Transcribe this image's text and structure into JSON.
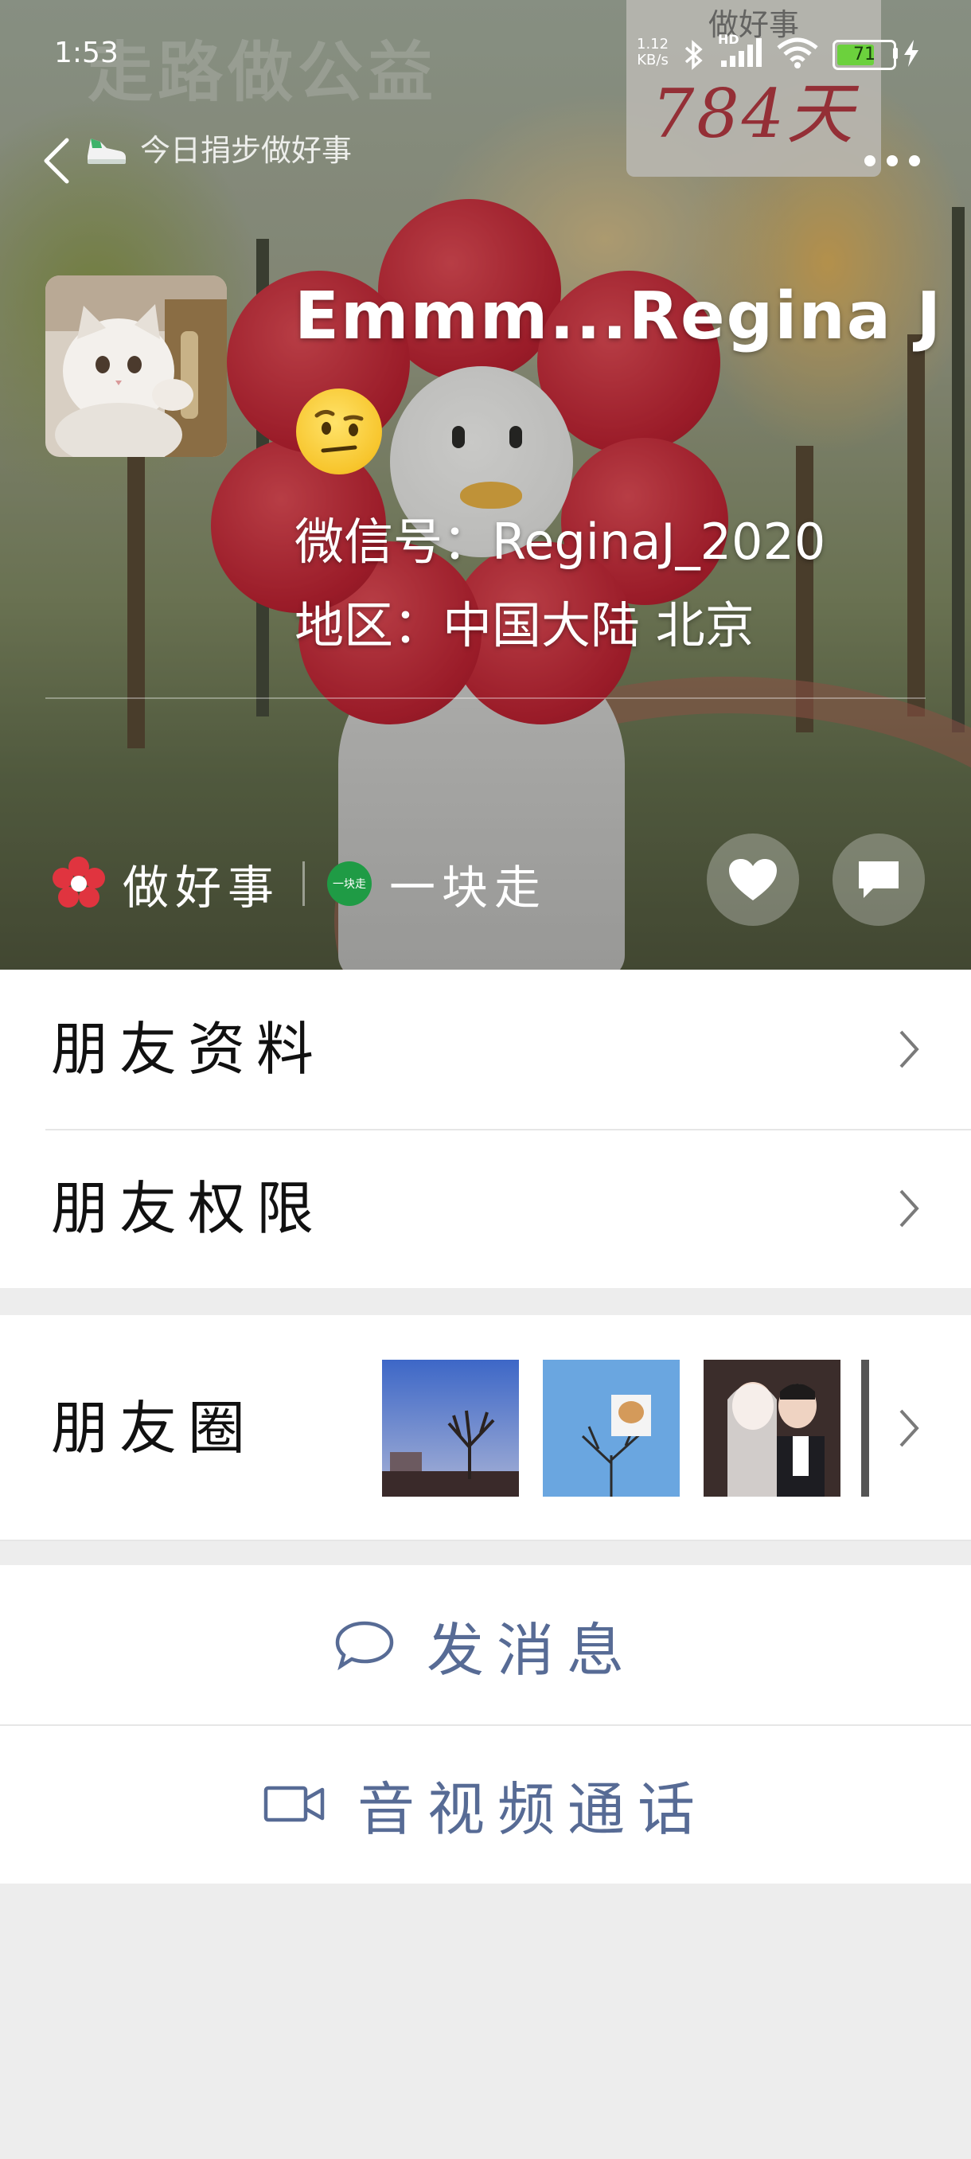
{
  "status_bar": {
    "time": "1:53",
    "net_speed_value": "1.12",
    "net_speed_unit": "KB/s",
    "hd_label": "HD",
    "battery": "71"
  },
  "nav": {
    "step_label": "今日捐步做好事"
  },
  "background": {
    "banner_text": "走路做公益",
    "sign_label": "做好事",
    "sign_days": "784天"
  },
  "profile": {
    "nickname": "Emmm...Regina J",
    "emoji": "raised-eyebrow-emoji",
    "wechat_id_line": "微信号：ReginaJ_2020",
    "region_line": "地区：中国大陆 北京",
    "status_name": "做好事",
    "companion_badge": "一块走",
    "companion_text": "一块走"
  },
  "menu": {
    "friend_info": "朋友资料",
    "friend_permissions": "朋友权限",
    "moments": "朋友圈"
  },
  "actions": {
    "message": "发消息",
    "call": "音视频通话"
  },
  "colors": {
    "action_blue": "#576b95",
    "page_bg": "#ededed",
    "flower_red": "#e0343f",
    "badge_green": "#1f9b45"
  }
}
